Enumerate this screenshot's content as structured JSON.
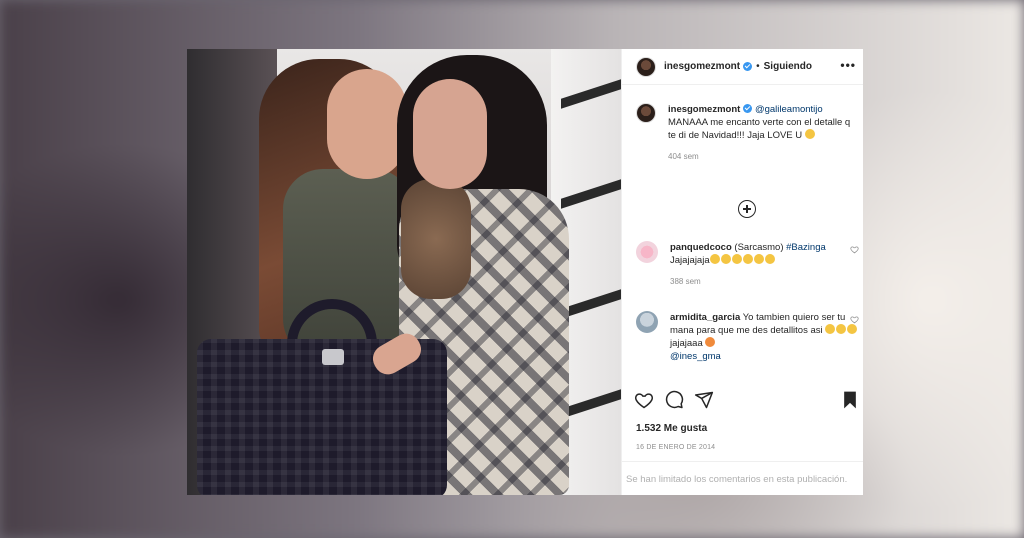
{
  "post": {
    "author": "inesgomezmont",
    "follow_status": "Siguiendo",
    "separator": "•",
    "more": "•••"
  },
  "caption": {
    "username": "inesgomezmont",
    "mention": "@galileamontijo",
    "text": "MANAAA me encanto verte con el detalle q te di de Navidad!!! Jaja LOVE U",
    "age": "404 sem"
  },
  "comments": [
    {
      "username": "panquedcoco",
      "text": "(Sarcasmo)",
      "hashtag": "#Bazinga",
      "text2": "Jajajajaja",
      "age": "388 sem"
    },
    {
      "username": "armidita_garcia",
      "text": "Yo tambien quiero ser tu mana para que me des detallitos asi",
      "text2": "jajajaaa",
      "mention": "@ines_gma"
    }
  ],
  "likes": "1.532 Me gusta",
  "date": "16 DE ENERO DE 2014",
  "comments_limited": "Se han limitado los comentarios en esta publicación.",
  "icons": {
    "heart": "heart-icon",
    "comment": "comment-icon",
    "share": "share-icon",
    "save": "bookmark-icon",
    "load_more": "plus-circle-icon"
  },
  "colors": {
    "verified": "#3897f0",
    "mention": "#00376b",
    "muted": "#8e8e8e"
  }
}
